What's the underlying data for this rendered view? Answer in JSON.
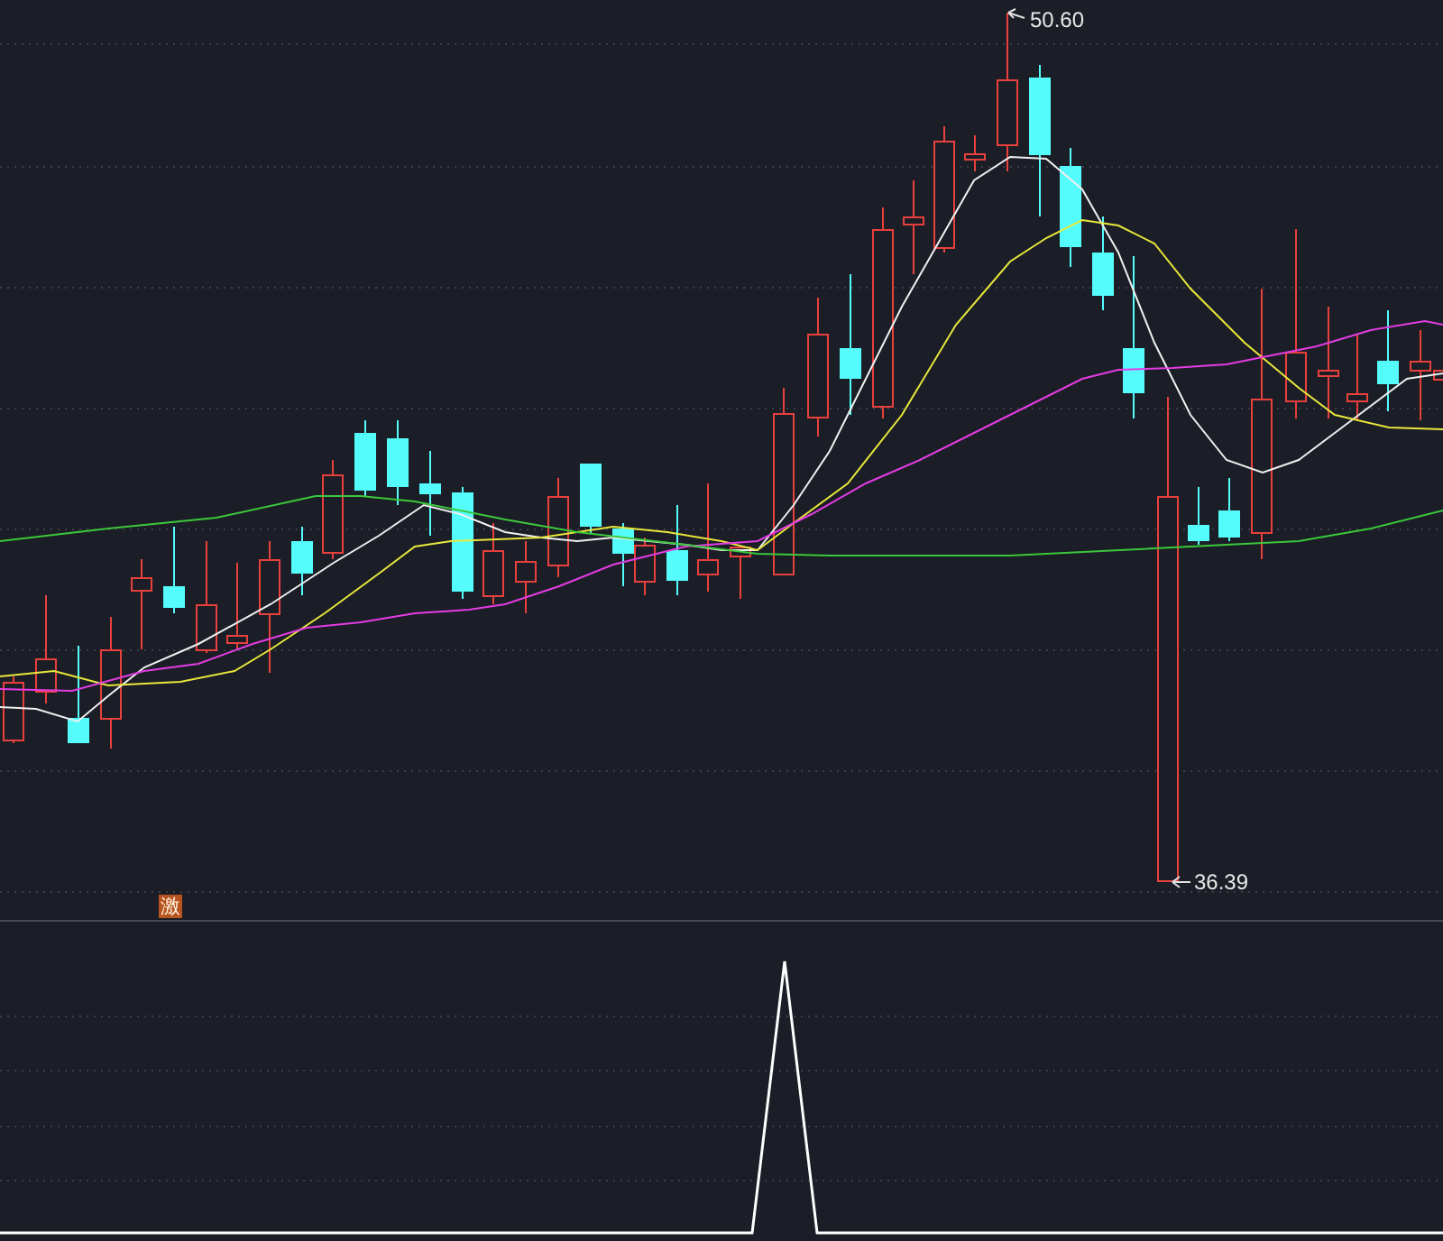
{
  "price_chart": {
    "high_label": "50.60",
    "low_label": "36.39",
    "signal_badge": "激"
  }
}
